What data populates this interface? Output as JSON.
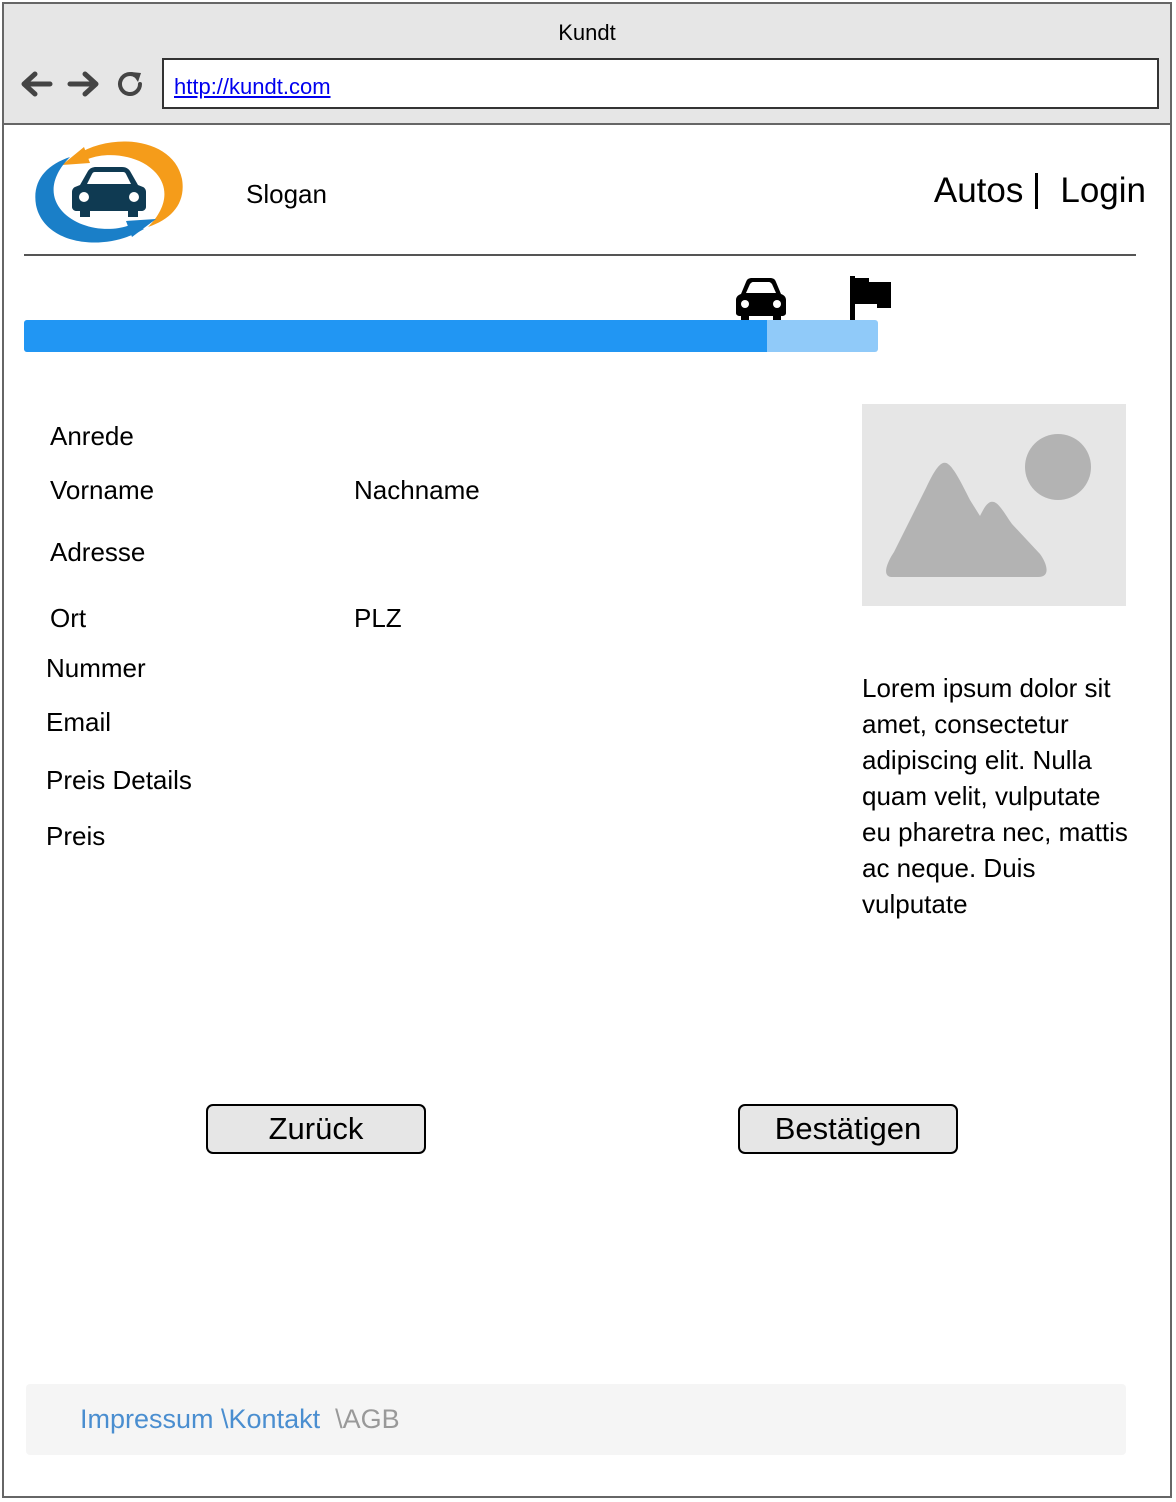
{
  "browser": {
    "window_title": "Kundt",
    "url": "http://kundt.com"
  },
  "header": {
    "slogan": "Slogan",
    "nav": [
      "Autos",
      "Login"
    ]
  },
  "progress": {
    "fraction": 0.87
  },
  "form": {
    "labels": {
      "anrede": "Anrede",
      "vorname": "Vorname",
      "nachname": "Nachname",
      "adresse": "Adresse",
      "ort": "Ort",
      "plz": "PLZ",
      "nummer": "Nummer",
      "email": "Email",
      "preis_details": "Preis Details",
      "preis": "Preis"
    }
  },
  "sidebar": {
    "text": "Lorem ipsum dolor sit amet, consectetur adipiscing elit. Nulla quam velit, vulputate eu pharetra nec, mattis ac neque. Duis vulputate"
  },
  "buttons": {
    "back": "Zurück",
    "confirm": "Bestätigen"
  },
  "footer": {
    "impressum": "Impressum ",
    "kontakt": "\\Kontakt",
    "agb": "  \\AGB"
  },
  "colors": {
    "progress_fill": "#2196f3",
    "progress_track": "#90caf9",
    "logo_blue": "#1a7fc8",
    "logo_orange": "#f59c1a",
    "logo_car": "#0f3a52",
    "footer_link": "#4a8ed0"
  },
  "icons": [
    "back-arrow-icon",
    "forward-arrow-icon",
    "reload-icon",
    "car-icon",
    "flag-icon",
    "image-placeholder-icon"
  ]
}
